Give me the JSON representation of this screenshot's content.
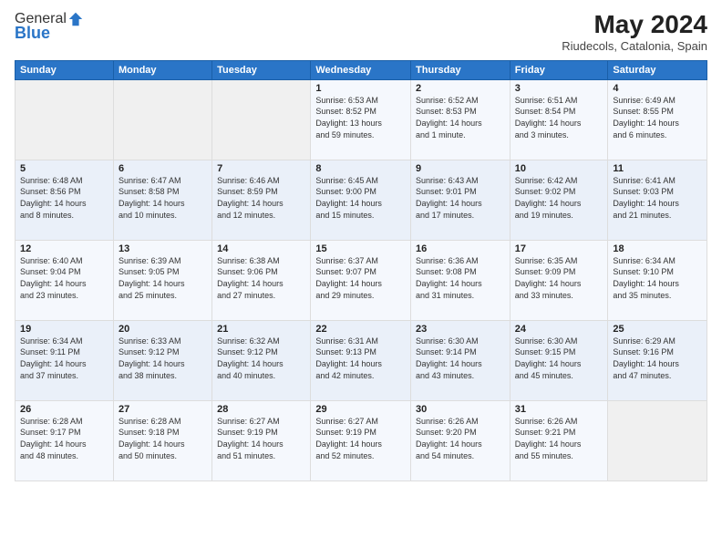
{
  "header": {
    "logo_line1": "General",
    "logo_line2": "Blue",
    "title": "May 2024",
    "subtitle": "Riudecols, Catalonia, Spain"
  },
  "calendar": {
    "days_of_week": [
      "Sunday",
      "Monday",
      "Tuesday",
      "Wednesday",
      "Thursday",
      "Friday",
      "Saturday"
    ],
    "weeks": [
      [
        {
          "day": "",
          "info": ""
        },
        {
          "day": "",
          "info": ""
        },
        {
          "day": "",
          "info": ""
        },
        {
          "day": "1",
          "info": "Sunrise: 6:53 AM\nSunset: 8:52 PM\nDaylight: 13 hours\nand 59 minutes."
        },
        {
          "day": "2",
          "info": "Sunrise: 6:52 AM\nSunset: 8:53 PM\nDaylight: 14 hours\nand 1 minute."
        },
        {
          "day": "3",
          "info": "Sunrise: 6:51 AM\nSunset: 8:54 PM\nDaylight: 14 hours\nand 3 minutes."
        },
        {
          "day": "4",
          "info": "Sunrise: 6:49 AM\nSunset: 8:55 PM\nDaylight: 14 hours\nand 6 minutes."
        }
      ],
      [
        {
          "day": "5",
          "info": "Sunrise: 6:48 AM\nSunset: 8:56 PM\nDaylight: 14 hours\nand 8 minutes."
        },
        {
          "day": "6",
          "info": "Sunrise: 6:47 AM\nSunset: 8:58 PM\nDaylight: 14 hours\nand 10 minutes."
        },
        {
          "day": "7",
          "info": "Sunrise: 6:46 AM\nSunset: 8:59 PM\nDaylight: 14 hours\nand 12 minutes."
        },
        {
          "day": "8",
          "info": "Sunrise: 6:45 AM\nSunset: 9:00 PM\nDaylight: 14 hours\nand 15 minutes."
        },
        {
          "day": "9",
          "info": "Sunrise: 6:43 AM\nSunset: 9:01 PM\nDaylight: 14 hours\nand 17 minutes."
        },
        {
          "day": "10",
          "info": "Sunrise: 6:42 AM\nSunset: 9:02 PM\nDaylight: 14 hours\nand 19 minutes."
        },
        {
          "day": "11",
          "info": "Sunrise: 6:41 AM\nSunset: 9:03 PM\nDaylight: 14 hours\nand 21 minutes."
        }
      ],
      [
        {
          "day": "12",
          "info": "Sunrise: 6:40 AM\nSunset: 9:04 PM\nDaylight: 14 hours\nand 23 minutes."
        },
        {
          "day": "13",
          "info": "Sunrise: 6:39 AM\nSunset: 9:05 PM\nDaylight: 14 hours\nand 25 minutes."
        },
        {
          "day": "14",
          "info": "Sunrise: 6:38 AM\nSunset: 9:06 PM\nDaylight: 14 hours\nand 27 minutes."
        },
        {
          "day": "15",
          "info": "Sunrise: 6:37 AM\nSunset: 9:07 PM\nDaylight: 14 hours\nand 29 minutes."
        },
        {
          "day": "16",
          "info": "Sunrise: 6:36 AM\nSunset: 9:08 PM\nDaylight: 14 hours\nand 31 minutes."
        },
        {
          "day": "17",
          "info": "Sunrise: 6:35 AM\nSunset: 9:09 PM\nDaylight: 14 hours\nand 33 minutes."
        },
        {
          "day": "18",
          "info": "Sunrise: 6:34 AM\nSunset: 9:10 PM\nDaylight: 14 hours\nand 35 minutes."
        }
      ],
      [
        {
          "day": "19",
          "info": "Sunrise: 6:34 AM\nSunset: 9:11 PM\nDaylight: 14 hours\nand 37 minutes."
        },
        {
          "day": "20",
          "info": "Sunrise: 6:33 AM\nSunset: 9:12 PM\nDaylight: 14 hours\nand 38 minutes."
        },
        {
          "day": "21",
          "info": "Sunrise: 6:32 AM\nSunset: 9:12 PM\nDaylight: 14 hours\nand 40 minutes."
        },
        {
          "day": "22",
          "info": "Sunrise: 6:31 AM\nSunset: 9:13 PM\nDaylight: 14 hours\nand 42 minutes."
        },
        {
          "day": "23",
          "info": "Sunrise: 6:30 AM\nSunset: 9:14 PM\nDaylight: 14 hours\nand 43 minutes."
        },
        {
          "day": "24",
          "info": "Sunrise: 6:30 AM\nSunset: 9:15 PM\nDaylight: 14 hours\nand 45 minutes."
        },
        {
          "day": "25",
          "info": "Sunrise: 6:29 AM\nSunset: 9:16 PM\nDaylight: 14 hours\nand 47 minutes."
        }
      ],
      [
        {
          "day": "26",
          "info": "Sunrise: 6:28 AM\nSunset: 9:17 PM\nDaylight: 14 hours\nand 48 minutes."
        },
        {
          "day": "27",
          "info": "Sunrise: 6:28 AM\nSunset: 9:18 PM\nDaylight: 14 hours\nand 50 minutes."
        },
        {
          "day": "28",
          "info": "Sunrise: 6:27 AM\nSunset: 9:19 PM\nDaylight: 14 hours\nand 51 minutes."
        },
        {
          "day": "29",
          "info": "Sunrise: 6:27 AM\nSunset: 9:19 PM\nDaylight: 14 hours\nand 52 minutes."
        },
        {
          "day": "30",
          "info": "Sunrise: 6:26 AM\nSunset: 9:20 PM\nDaylight: 14 hours\nand 54 minutes."
        },
        {
          "day": "31",
          "info": "Sunrise: 6:26 AM\nSunset: 9:21 PM\nDaylight: 14 hours\nand 55 minutes."
        },
        {
          "day": "",
          "info": ""
        }
      ]
    ]
  }
}
